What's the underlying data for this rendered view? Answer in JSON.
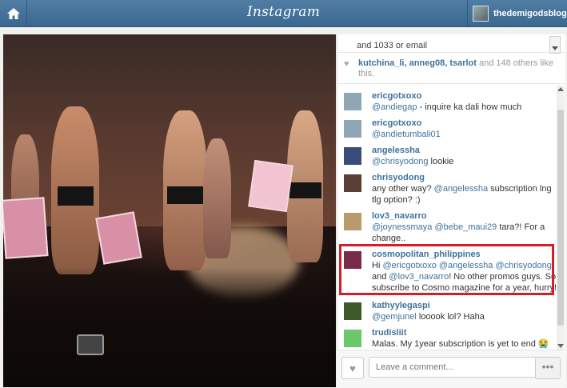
{
  "header": {
    "logo": "Instagram",
    "username": "thedemigodsblog"
  },
  "caption_snippet": "and 1033 or email",
  "likes": {
    "names": "kutchina_li, anneg08, tsarlot",
    "rest": " and 148 others like this."
  },
  "comments": [
    {
      "user": "ericgotxoxo",
      "mention": "@andiegap",
      "text": " - inquire ka dali how much",
      "avatar_color": "#8fa7b5"
    },
    {
      "user": "ericgotxoxo",
      "mention": "@andietumbali01",
      "text": "",
      "avatar_color": "#8fa7b5"
    },
    {
      "user": "angelessha",
      "mention": "@chrisyodong",
      "text": " lookie",
      "avatar_color": "#3a4c7a"
    },
    {
      "user": "chrisyodong",
      "mention": "",
      "text": "any other way? ",
      "mention2": "@angelessha",
      "text2": " subscription lng tlg option? :)",
      "avatar_color": "#5a3f36"
    },
    {
      "user": "lov3_navarro",
      "mention": "@joynessmaya",
      "text": " ",
      "mention2": "@bebe_maui29",
      "text2": " tara?! For a change..",
      "avatar_color": "#b89a6c"
    },
    {
      "user": "cosmopolitan_philippines",
      "pre": "Hi ",
      "mention": "@ericgotxoxo @angelessha @chrisyodong",
      "text": " and ",
      "mention2": "@lov3_navarro",
      "text2": "! No other promos guys. So subscribe to Cosmo magazine for a year, hurry!",
      "avatar_color": "#7a2a4a"
    },
    {
      "user": "kathyylegaspi",
      "mention": "@gemjunel",
      "text": " looook lol? Haha",
      "avatar_color": "#3f5a2a"
    },
    {
      "user": "trudisliit",
      "mention": "",
      "text": "Malas. My 1year subscription is yet to end ",
      "emoji": "😭😭😭",
      "avatar_color": "#69c96a"
    }
  ],
  "comment_box": {
    "placeholder": "Leave a comment...",
    "more": "•••"
  },
  "icons": {
    "home": "home-icon",
    "heart": "heart-icon"
  }
}
